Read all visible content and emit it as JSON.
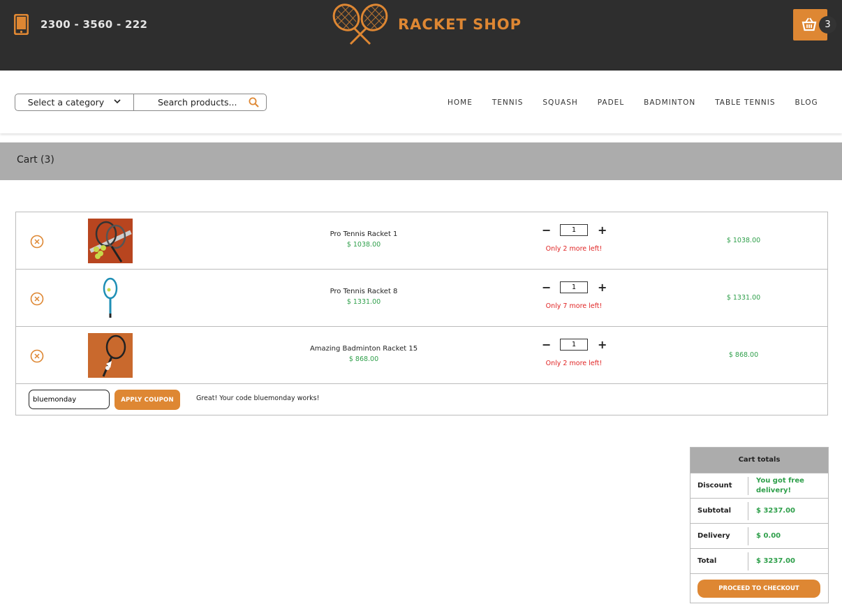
{
  "header": {
    "phone": "2300 - 3560 - 222",
    "brand": "RACKET SHOP",
    "cart_count": "3",
    "accent_color": "#de8733"
  },
  "search": {
    "category_label": "Select a category",
    "placeholder": "Search products..."
  },
  "nav": {
    "items": [
      "HOME",
      "TENNIS",
      "SQUASH",
      "PADEL",
      "BADMINTON",
      "TABLE TENNIS",
      "BLOG"
    ]
  },
  "page": {
    "title": "Cart (3)"
  },
  "cart": {
    "items": [
      {
        "name": "Pro Tennis Racket 1",
        "price": "$ 1038.00",
        "qty": "1",
        "stock": "Only 2 more left!",
        "total": "$ 1038.00"
      },
      {
        "name": "Pro Tennis Racket 8",
        "price": "$ 1331.00",
        "qty": "1",
        "stock": "Only 7 more left!",
        "total": "$ 1331.00"
      },
      {
        "name": "Amazing Badminton Racket 15",
        "price": "$ 868.00",
        "qty": "1",
        "stock": "Only 2 more left!",
        "total": "$ 868.00"
      }
    ],
    "qty_minus": "−",
    "qty_plus": "+",
    "coupon": {
      "value": "bluemonday",
      "button": "APPLY COUPON",
      "message": "Great! Your code bluemonday works!"
    }
  },
  "totals": {
    "title": "Cart totals",
    "rows": [
      {
        "label": "Discount",
        "value": "You got free delivery!"
      },
      {
        "label": "Subtotal",
        "value": "$ 3237.00"
      },
      {
        "label": "Delivery",
        "value": "$ 0.00"
      },
      {
        "label": "Total",
        "value": "$ 3237.00"
      }
    ],
    "checkout": "PROCEED TO CHECKOUT"
  }
}
